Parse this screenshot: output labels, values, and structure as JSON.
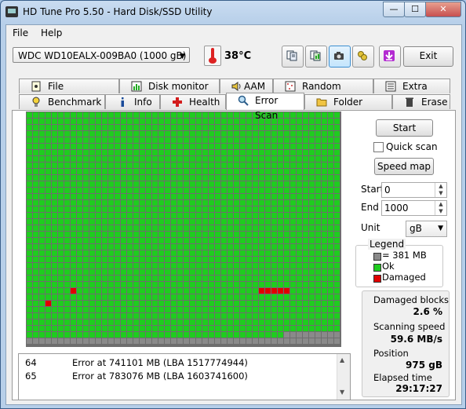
{
  "window": {
    "title": "HD Tune Pro 5.50 - Hard Disk/SSD Utility",
    "min_glyph": "—",
    "max_glyph": "☐",
    "close_glyph": "✕"
  },
  "menu": [
    {
      "label": "File"
    },
    {
      "label": "Help"
    }
  ],
  "toolbar": {
    "drive": "WDC WD10EALX-009BA0 (1000 gB)",
    "temperature": "38",
    "temperature_unit": "°C",
    "exit_label": "Exit",
    "icons": [
      "copy-text-icon",
      "copy-image-icon",
      "screenshot-icon",
      "options-icon",
      "download-icon"
    ]
  },
  "tabs_top": [
    {
      "label": "File Benchmark",
      "icon": "file-benchmark-icon"
    },
    {
      "label": "Disk monitor",
      "icon": "disk-monitor-icon"
    },
    {
      "label": "AAM",
      "icon": "speaker-icon"
    },
    {
      "label": "Random Access",
      "icon": "random-access-icon"
    },
    {
      "label": "Extra tests",
      "icon": "extra-tests-icon"
    }
  ],
  "tabs_bottom": [
    {
      "label": "Benchmark",
      "icon": "lightbulb-icon"
    },
    {
      "label": "Info",
      "icon": "info-icon"
    },
    {
      "label": "Health",
      "icon": "health-cross-icon"
    },
    {
      "label": "Error Scan",
      "icon": "magnifier-icon",
      "selected": true
    },
    {
      "label": "Folder Usage",
      "icon": "folder-icon"
    },
    {
      "label": "Erase",
      "icon": "trash-icon"
    }
  ],
  "scan_map": {
    "columns": 50,
    "rows": 37,
    "colors": {
      "ok": "#1fcc1f",
      "damaged": "#e00000",
      "unscanned": "#8a8a8a"
    },
    "damaged_cells": [
      [
        28,
        7
      ],
      [
        28,
        37
      ],
      [
        28,
        38
      ],
      [
        28,
        39
      ],
      [
        28,
        40
      ],
      [
        28,
        41
      ],
      [
        30,
        3
      ]
    ],
    "unscanned_row": 36,
    "unscanned_extra_row": 35,
    "unscanned_extra_from_col": 41
  },
  "log": [
    {
      "num": "64",
      "text": "Error at 741101 MB (LBA 1517774944)"
    },
    {
      "num": "65",
      "text": "Error at 783076 MB (LBA 1603741600)"
    }
  ],
  "controls": {
    "start_button": "Start",
    "quick_scan_label": "Quick scan",
    "quick_scan_checked": false,
    "speed_map_button": "Speed map",
    "start_label": "Start",
    "start_value": "0",
    "end_label": "End",
    "end_value": "1000",
    "unit_label": "Unit",
    "unit_value": "gB"
  },
  "legend": {
    "title": "Legend",
    "items": [
      {
        "label": "= 381 MB",
        "color": "#8a8a8a"
      },
      {
        "label": "Ok",
        "color": "#1fcc1f"
      },
      {
        "label": "Damaged",
        "color": "#e00000"
      }
    ]
  },
  "stats": {
    "damaged_blocks_label": "Damaged blocks",
    "damaged_blocks_value": "2.6 %",
    "scanning_speed_label": "Scanning speed",
    "scanning_speed_value": "59.6 MB/s",
    "position_label": "Position",
    "position_value": "975 gB",
    "elapsed_label": "Elapsed time",
    "elapsed_value": "29:17:27"
  }
}
